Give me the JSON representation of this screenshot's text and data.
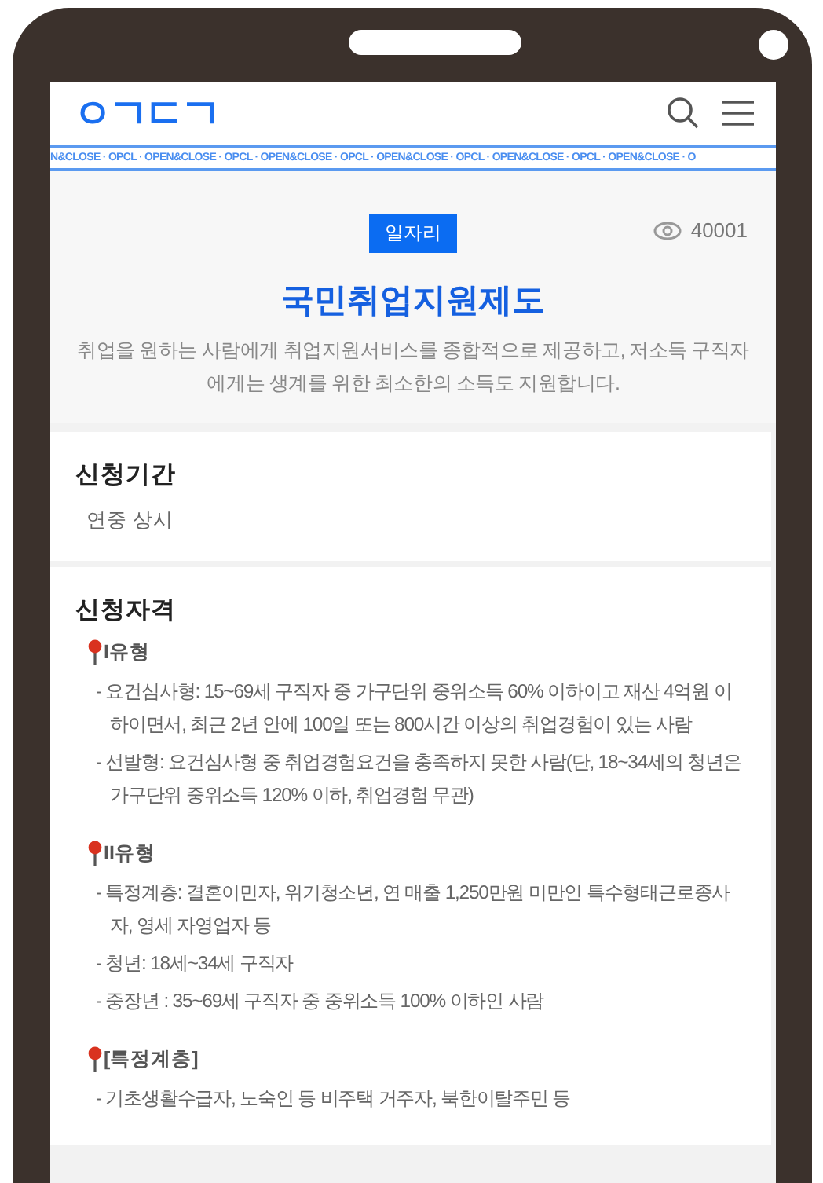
{
  "header": {
    "logo": "ㅇㄱㄷㄱ"
  },
  "marquee": "N&CLOSE · OPCL · OPEN&CLOSE · OPCL · OPEN&CLOSE · OPCL · OPEN&CLOSE · OPCL · OPEN&CLOSE · OPCL · OPEN&CLOSE · O",
  "hero": {
    "category": "일자리",
    "views": "40001",
    "title": "국민취업지원제도",
    "description": "취업을 원하는 사람에게 취업지원서비스를 종합적으로 제공하고, 저소득 구직자에게는 생계를 위한 최소한의 소득도 지원합니다."
  },
  "sections": [
    {
      "heading": "신청기간",
      "blocks": [
        {
          "kind": "plain",
          "text": "연중 상시"
        }
      ]
    },
    {
      "heading": "신청자격",
      "blocks": [
        {
          "kind": "group",
          "label": "I유형",
          "items": [
            "- 요건심사형: 15~69세 구직자 중 가구단위 중위소득 60% 이하이고 재산 4억원 이하이면서, 최근 2년 안에 100일 또는 800시간 이상의 취업경험이 있는 사람",
            "- 선발형: 요건심사형 중 취업경험요건을 충족하지 못한 사람(단, 18~34세의 청년은 가구단위 중위소득 120% 이하, 취업경험 무관)"
          ]
        },
        {
          "kind": "group",
          "label": "II유형",
          "items": [
            "- 특정계층: 결혼이민자, 위기청소년, 연 매출 1,250만원 미만인 특수형태근로종사자, 영세 자영업자 등",
            "- 청년: 18세~34세 구직자",
            "- 중장년 : 35~69세 구직자 중 중위소득 100% 이하인 사람"
          ]
        },
        {
          "kind": "group",
          "label": "[특정계층]",
          "items": [
            "- 기초생활수급자, 노숙인 등 비주택 거주자, 북한이탈주민 등"
          ]
        }
      ]
    }
  ]
}
